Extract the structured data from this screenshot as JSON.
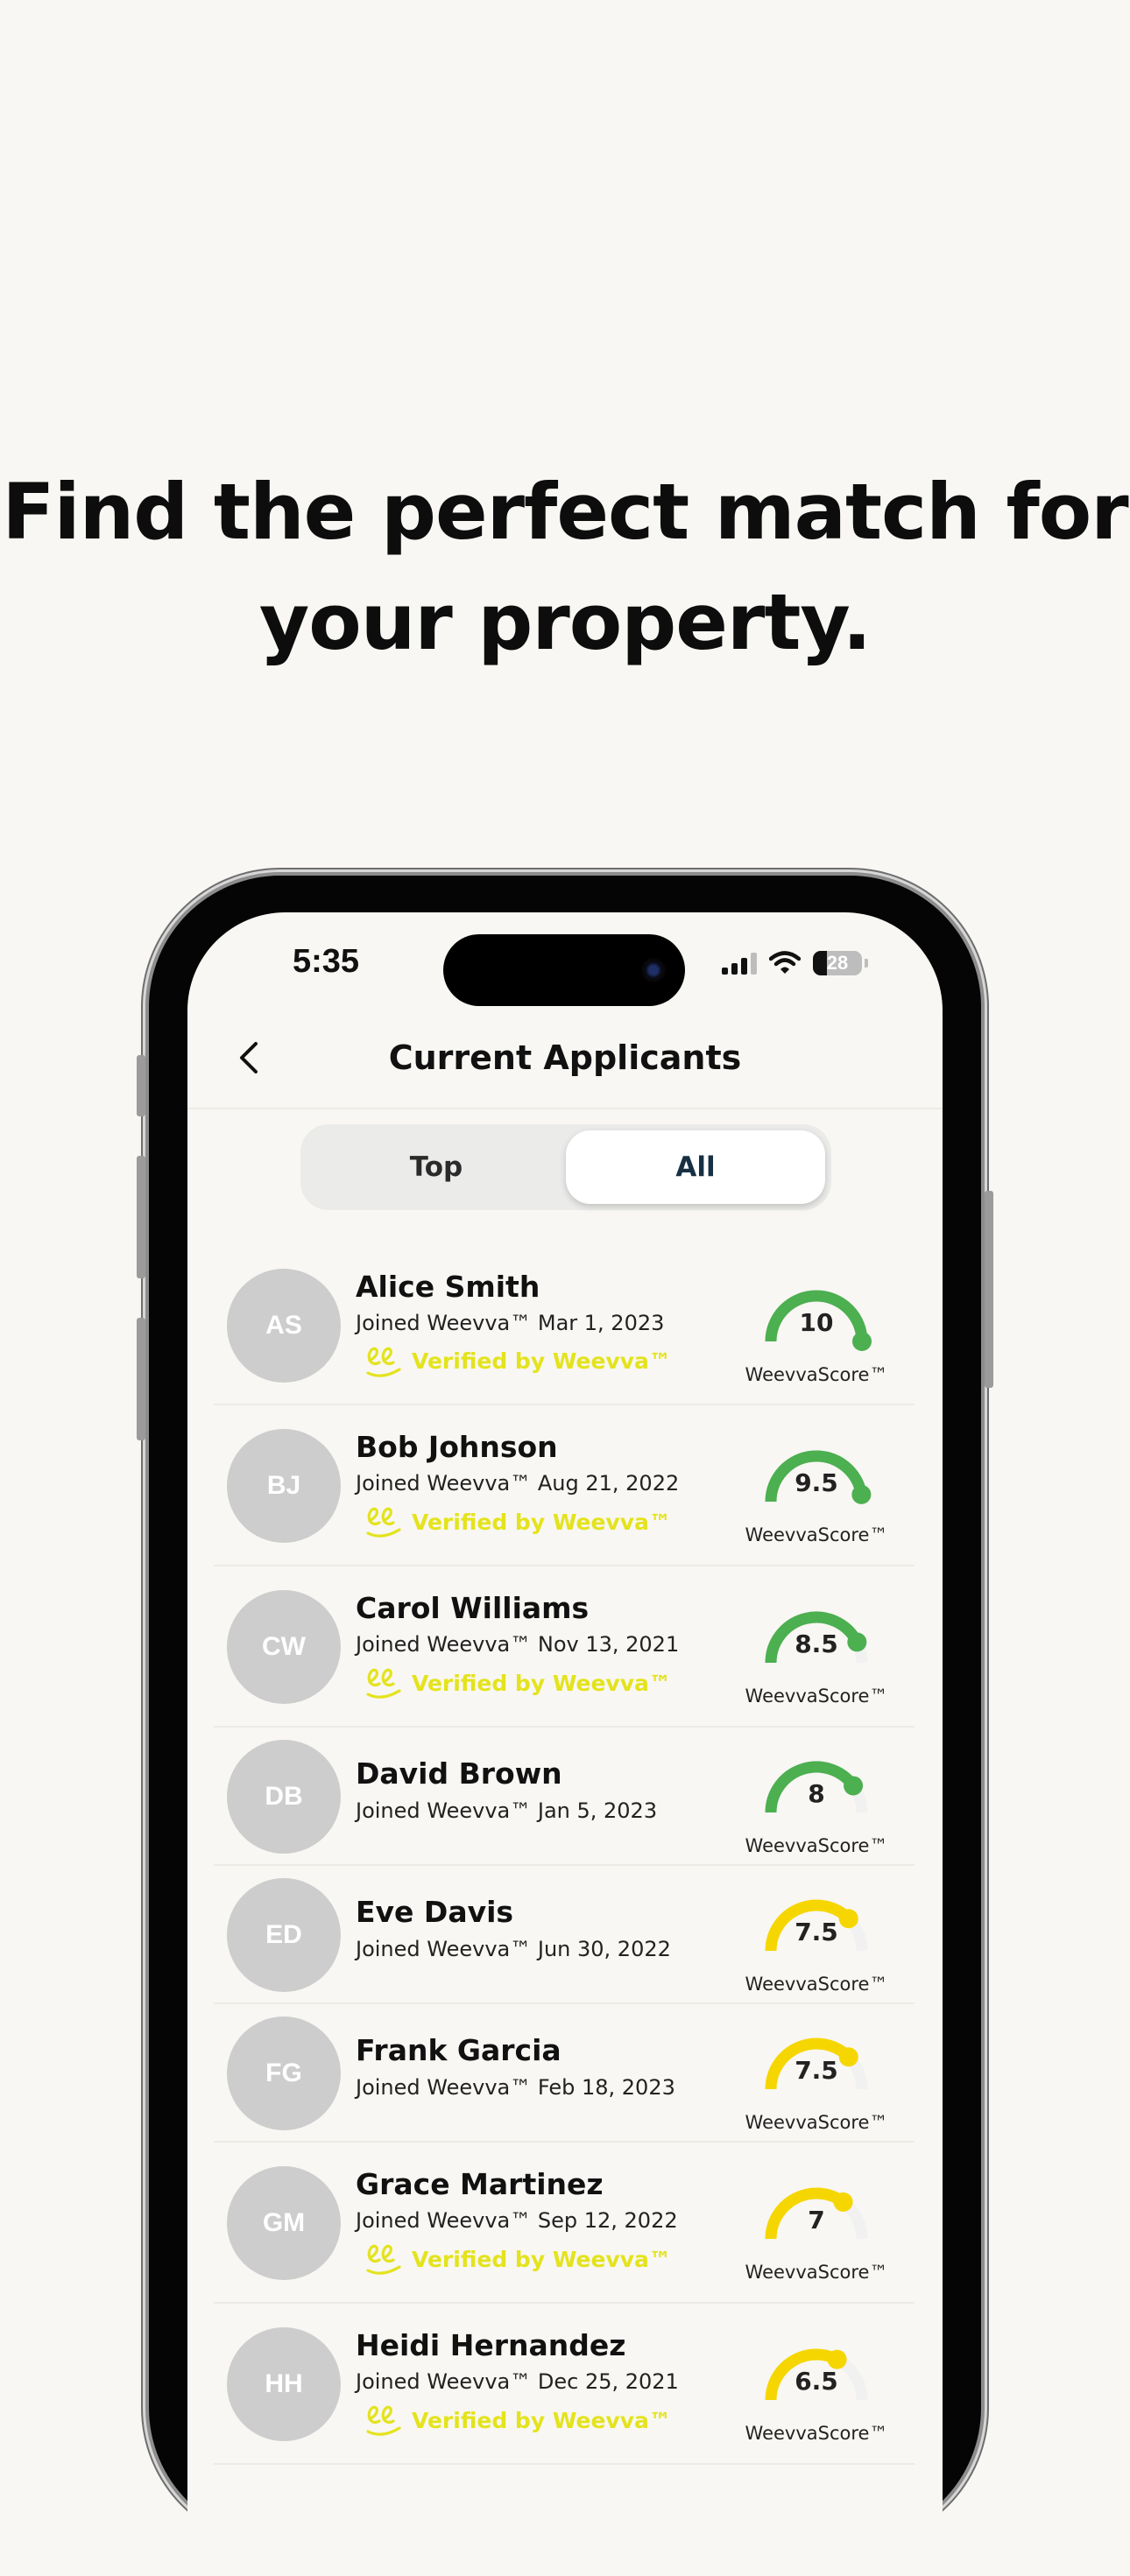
{
  "headline": {
    "line1": "Find the perfect match for",
    "line2": "your property."
  },
  "status_bar": {
    "time": "5:35",
    "battery": "28"
  },
  "nav": {
    "title": "Current Applicants",
    "back_icon": "chevron-left-icon"
  },
  "tabs": [
    {
      "label": "Top",
      "selected": false
    },
    {
      "label": "All",
      "selected": true
    }
  ],
  "score_label": "WeevvaScore™",
  "verified_label": "Verified by Weevva™",
  "colors": {
    "green": "#4caf50",
    "yellow": "#f6d600",
    "verified": "#e4e31d",
    "track": "#f1f1f1"
  },
  "applicants": [
    {
      "initials": "AS",
      "name": "Alice Smith",
      "joined": "Joined Weevva™ Mar 1, 2023",
      "verified": true,
      "score": "10",
      "score_value": 10,
      "level": "green"
    },
    {
      "initials": "BJ",
      "name": "Bob Johnson",
      "joined": "Joined Weevva™ Aug 21, 2022",
      "verified": true,
      "score": "9.5",
      "score_value": 9.5,
      "level": "green"
    },
    {
      "initials": "CW",
      "name": "Carol Williams",
      "joined": "Joined Weevva™ Nov 13, 2021",
      "verified": true,
      "score": "8.5",
      "score_value": 8.5,
      "level": "green"
    },
    {
      "initials": "DB",
      "name": "David Brown",
      "joined": "Joined Weevva™ Jan 5, 2023",
      "verified": false,
      "score": "8",
      "score_value": 8,
      "level": "green"
    },
    {
      "initials": "ED",
      "name": "Eve Davis",
      "joined": "Joined Weevva™ Jun 30, 2022",
      "verified": false,
      "score": "7.5",
      "score_value": 7.5,
      "level": "yellow"
    },
    {
      "initials": "FG",
      "name": "Frank Garcia",
      "joined": "Joined Weevva™ Feb 18, 2023",
      "verified": false,
      "score": "7.5",
      "score_value": 7.5,
      "level": "yellow"
    },
    {
      "initials": "GM",
      "name": "Grace Martinez",
      "joined": "Joined Weevva™ Sep 12, 2022",
      "verified": true,
      "score": "7",
      "score_value": 7,
      "level": "yellow"
    },
    {
      "initials": "HH",
      "name": "Heidi Hernandez",
      "joined": "Joined Weevva™ Dec 25, 2021",
      "verified": true,
      "score": "6.5",
      "score_value": 6.5,
      "level": "yellow"
    }
  ]
}
